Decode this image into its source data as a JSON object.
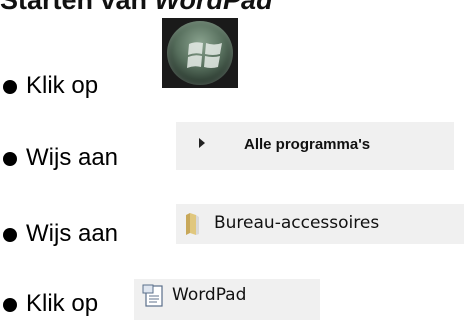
{
  "heading": {
    "prefix": "Starten van ",
    "app": "WordPad"
  },
  "steps": [
    {
      "text": "Klik op",
      "target": "windows-start-orb"
    },
    {
      "text": "Wijs aan",
      "target_label": "Alle programma's"
    },
    {
      "text": "Wijs aan",
      "target_label": "Bureau-accessoires"
    },
    {
      "text": "Klik op",
      "target_label": "WordPad"
    }
  ],
  "icons": {
    "start": "windows-orb-icon",
    "arrow": "triangle-right-icon",
    "folder": "folder-icon",
    "wordpad": "wordpad-icon"
  }
}
